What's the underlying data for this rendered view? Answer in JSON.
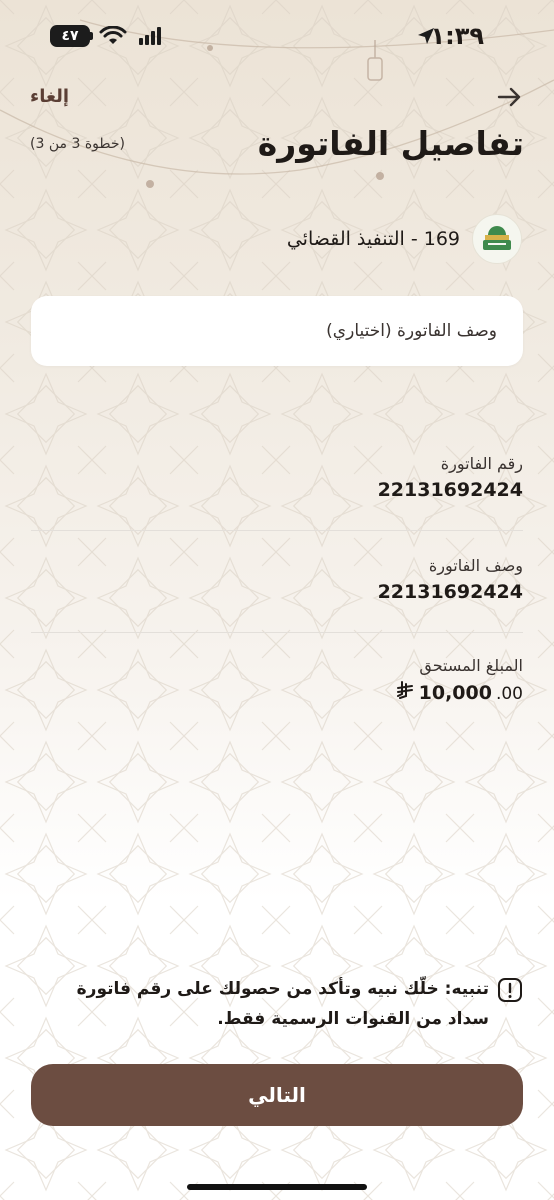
{
  "status_bar": {
    "time": "١:٣٩",
    "battery": "٤٧"
  },
  "header": {
    "cancel_label": "إلغاء",
    "title": "تفاصيل الفاتورة",
    "step": "(خطوة 3 من 3)"
  },
  "biller": {
    "name": "169 - التنفيذ القضائي"
  },
  "description_input": {
    "placeholder": "وصف الفاتورة (اختياري)"
  },
  "details": {
    "bill_number_label": "رقم الفاتورة",
    "bill_number_value": "22131692424",
    "bill_description_label": "وصف الفاتورة",
    "bill_description_value": "22131692424",
    "amount_label": "المبلغ المستحق",
    "amount_integer": "10,000",
    "amount_decimal": ".00"
  },
  "warning": {
    "text": "تنبيه: خلّك نبيه وتأكد من حصولك على رقم فاتورة سداد من القنوات الرسمية فقط."
  },
  "footer": {
    "next_label": "التالي"
  },
  "colors": {
    "primary_button": "#6c4d41",
    "cancel_link": "#5b3f35"
  }
}
